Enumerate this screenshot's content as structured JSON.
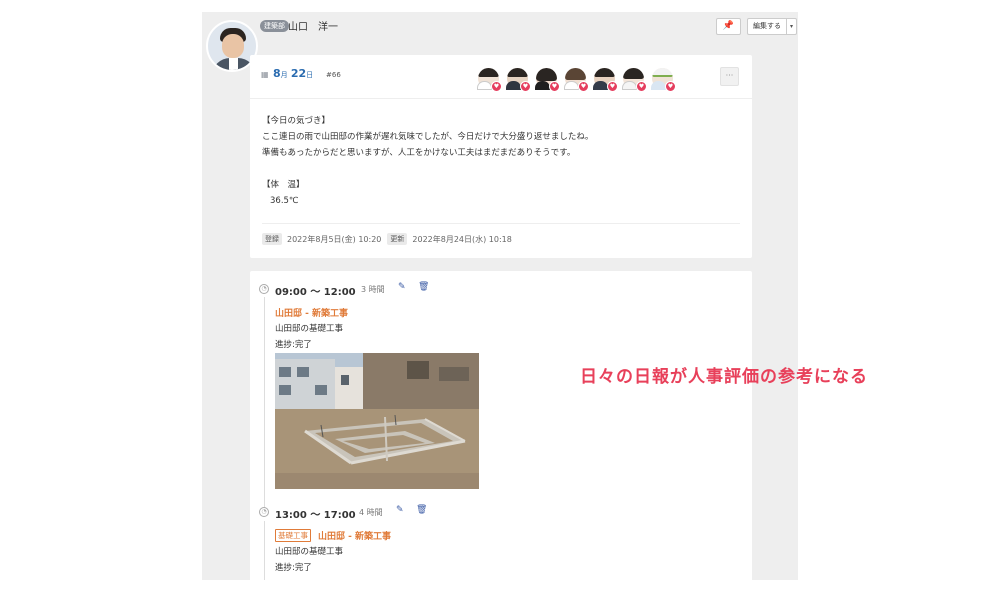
{
  "header": {
    "department": "建築部",
    "user_name": "山口　洋一",
    "pin_icon": "pin-icon",
    "edit_label": "編集する",
    "edit_caret": "▾"
  },
  "report": {
    "calendar_icon": "calendar-icon",
    "month": "8",
    "month_unit": "月",
    "day": "22",
    "day_unit": "日",
    "number": "#66",
    "like_icon": "thumbs-up-icon",
    "more_label": "···",
    "lines": [
      "【今日の気づき】",
      "ここ連日の雨で山田邸の作業が遅れ気味でしたが、今日だけで大分盛り返せましたね。",
      "準備もあったからだと思いますが、人工をかけない工夫はまだまだありそうです。"
    ],
    "temp_heading": "【体　温】",
    "temp_value": "36.5℃",
    "registered_label": "登録",
    "registered_value": "2022年8月5日(金) 10:20",
    "updated_label": "更新",
    "updated_value": "2022年8月24日(水) 10:18"
  },
  "entries": [
    {
      "time": "09:00 ～ 12:00",
      "hours": "3 時間",
      "project": "山田邸 - 新築工事",
      "task": "山田邸の基礎工事",
      "progress": "進捗:完了"
    },
    {
      "time": "13:00 ～ 17:00",
      "hours": "4 時間",
      "category": "基礎工事",
      "project": "山田邸 - 新築工事",
      "task": "山田邸の基礎工事",
      "progress": "進捗:完了"
    }
  ],
  "caption": "日々の日報が人事評価の参考になる",
  "colors": {
    "accent_blue": "#2b6cb0",
    "project_orange": "#e07b39",
    "caption_red": "#e8405a",
    "like_red": "#e53e5e"
  }
}
